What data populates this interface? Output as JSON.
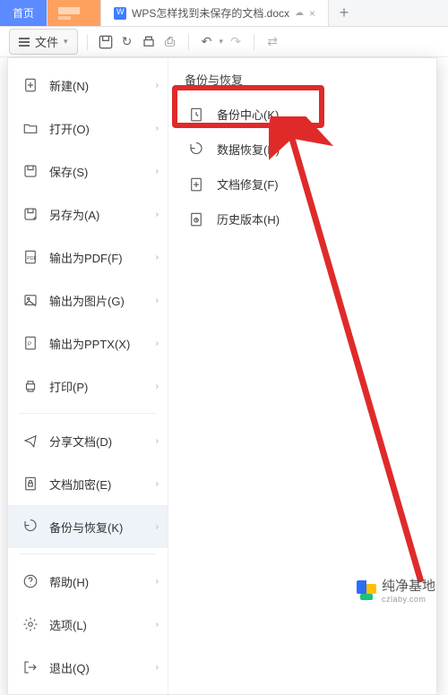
{
  "tabs": {
    "home": "首页",
    "doc_title": "WPS怎样找到未保存的文档.docx",
    "add": "+"
  },
  "toolbar": {
    "file_label": "文件"
  },
  "menu": {
    "items": [
      {
        "label": "新建(N)",
        "name": "new"
      },
      {
        "label": "打开(O)",
        "name": "open"
      },
      {
        "label": "保存(S)",
        "name": "save"
      },
      {
        "label": "另存为(A)",
        "name": "save-as"
      },
      {
        "label": "输出为PDF(F)",
        "name": "export-pdf"
      },
      {
        "label": "输出为图片(G)",
        "name": "export-image"
      },
      {
        "label": "输出为PPTX(X)",
        "name": "export-pptx"
      },
      {
        "label": "打印(P)",
        "name": "print"
      },
      {
        "label": "分享文档(D)",
        "name": "share"
      },
      {
        "label": "文档加密(E)",
        "name": "encrypt"
      },
      {
        "label": "备份与恢复(K)",
        "name": "backup-restore",
        "selected": true
      },
      {
        "label": "帮助(H)",
        "name": "help"
      },
      {
        "label": "选项(L)",
        "name": "options"
      },
      {
        "label": "退出(Q)",
        "name": "exit"
      }
    ]
  },
  "submenu": {
    "title": "备份与恢复",
    "items": [
      {
        "label": "备份中心(K)...",
        "name": "backup-center",
        "highlight": true
      },
      {
        "label": "数据恢复(R)",
        "name": "data-recover"
      },
      {
        "label": "文档修复(F)",
        "name": "doc-repair"
      },
      {
        "label": "历史版本(H)",
        "name": "history"
      }
    ]
  },
  "watermark": {
    "text": "纯净基地",
    "sub": "czlaby.com"
  }
}
